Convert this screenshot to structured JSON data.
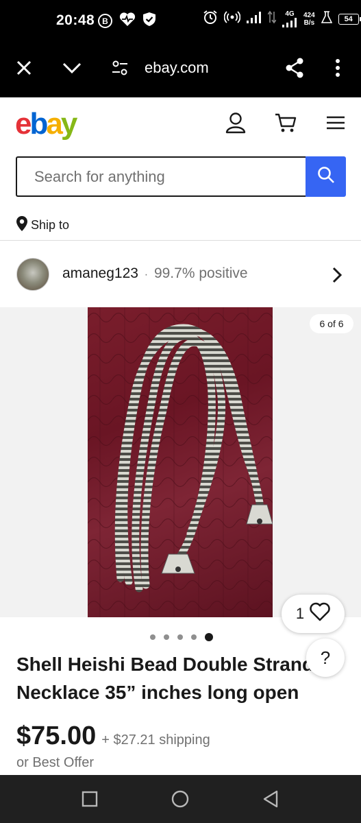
{
  "status_bar": {
    "time": "20:48",
    "badge_letter": "B",
    "network": "4G",
    "speed_value": "424",
    "speed_unit": "B/s",
    "battery": "54"
  },
  "browser": {
    "url": "ebay.com"
  },
  "header": {
    "logo_letters": [
      "e",
      "b",
      "a",
      "y"
    ]
  },
  "search": {
    "placeholder": "Search for anything"
  },
  "ship_to": {
    "label": "Ship to"
  },
  "seller": {
    "name": "amaneg123",
    "separator": "·",
    "feedback": "99.7% positive"
  },
  "gallery": {
    "counter": "6 of 6",
    "total_images": 5,
    "active_index": 5
  },
  "watch": {
    "count": "1"
  },
  "help": {
    "label": "?"
  },
  "item": {
    "title_line1": "Shell Heishi Bead Double Strand",
    "title_line2": "Necklace 35” inches long open",
    "price": "$75.00",
    "shipping": "+ $27.21 shipping",
    "best_offer": "or Best Offer"
  },
  "colors": {
    "ebay_red": "#e53238",
    "ebay_blue": "#0064d2",
    "ebay_yellow": "#f5af02",
    "ebay_green": "#86b817",
    "search_button": "#3665f3"
  }
}
